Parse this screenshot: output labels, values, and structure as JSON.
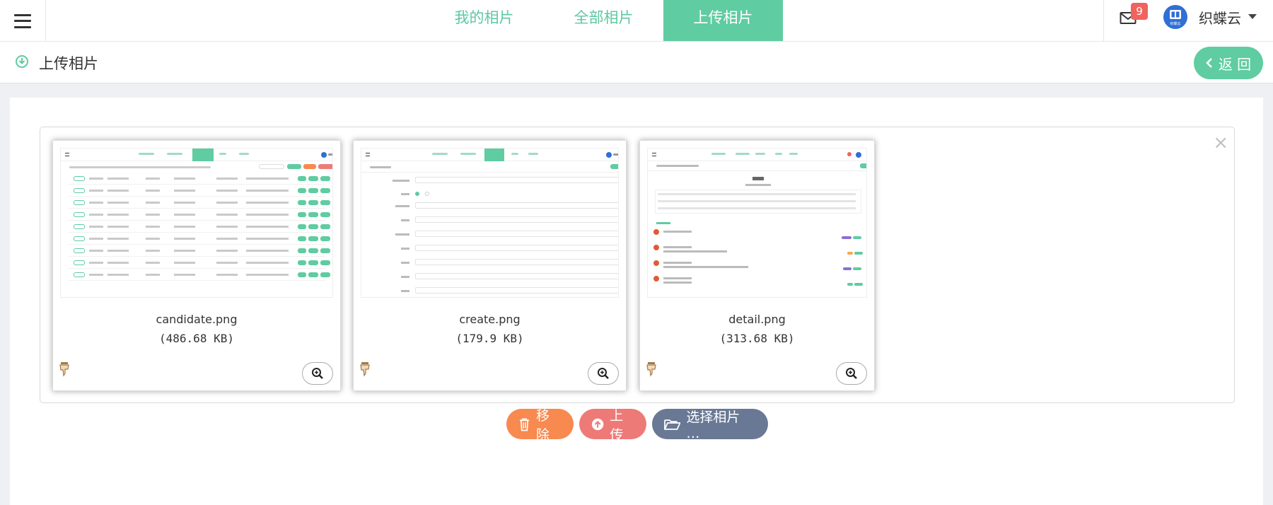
{
  "header": {
    "tabs": [
      {
        "label": "我的相片",
        "active": false
      },
      {
        "label": "全部相片",
        "active": false
      },
      {
        "label": "上传相片",
        "active": true
      }
    ],
    "mail_count": "9",
    "user_name": "织蝶云",
    "avatar_text": "织蝶云"
  },
  "subheader": {
    "title": "上传相片",
    "back_label": "返 回"
  },
  "files": [
    {
      "name": "candidate.png",
      "size": "(486.68 KB)"
    },
    {
      "name": "create.png",
      "size": "(179.9 KB)"
    },
    {
      "name": "detail.png",
      "size": "(313.68 KB)"
    }
  ],
  "actions": {
    "remove_label": "移除",
    "upload_label": "上传",
    "select_label": "选择相片 …"
  },
  "close_symbol": "×",
  "colors": {
    "accent": "#5fcca1",
    "remove": "#f8894f",
    "upload": "#ee7a78",
    "select": "#697894",
    "badge": "#f0645f"
  }
}
